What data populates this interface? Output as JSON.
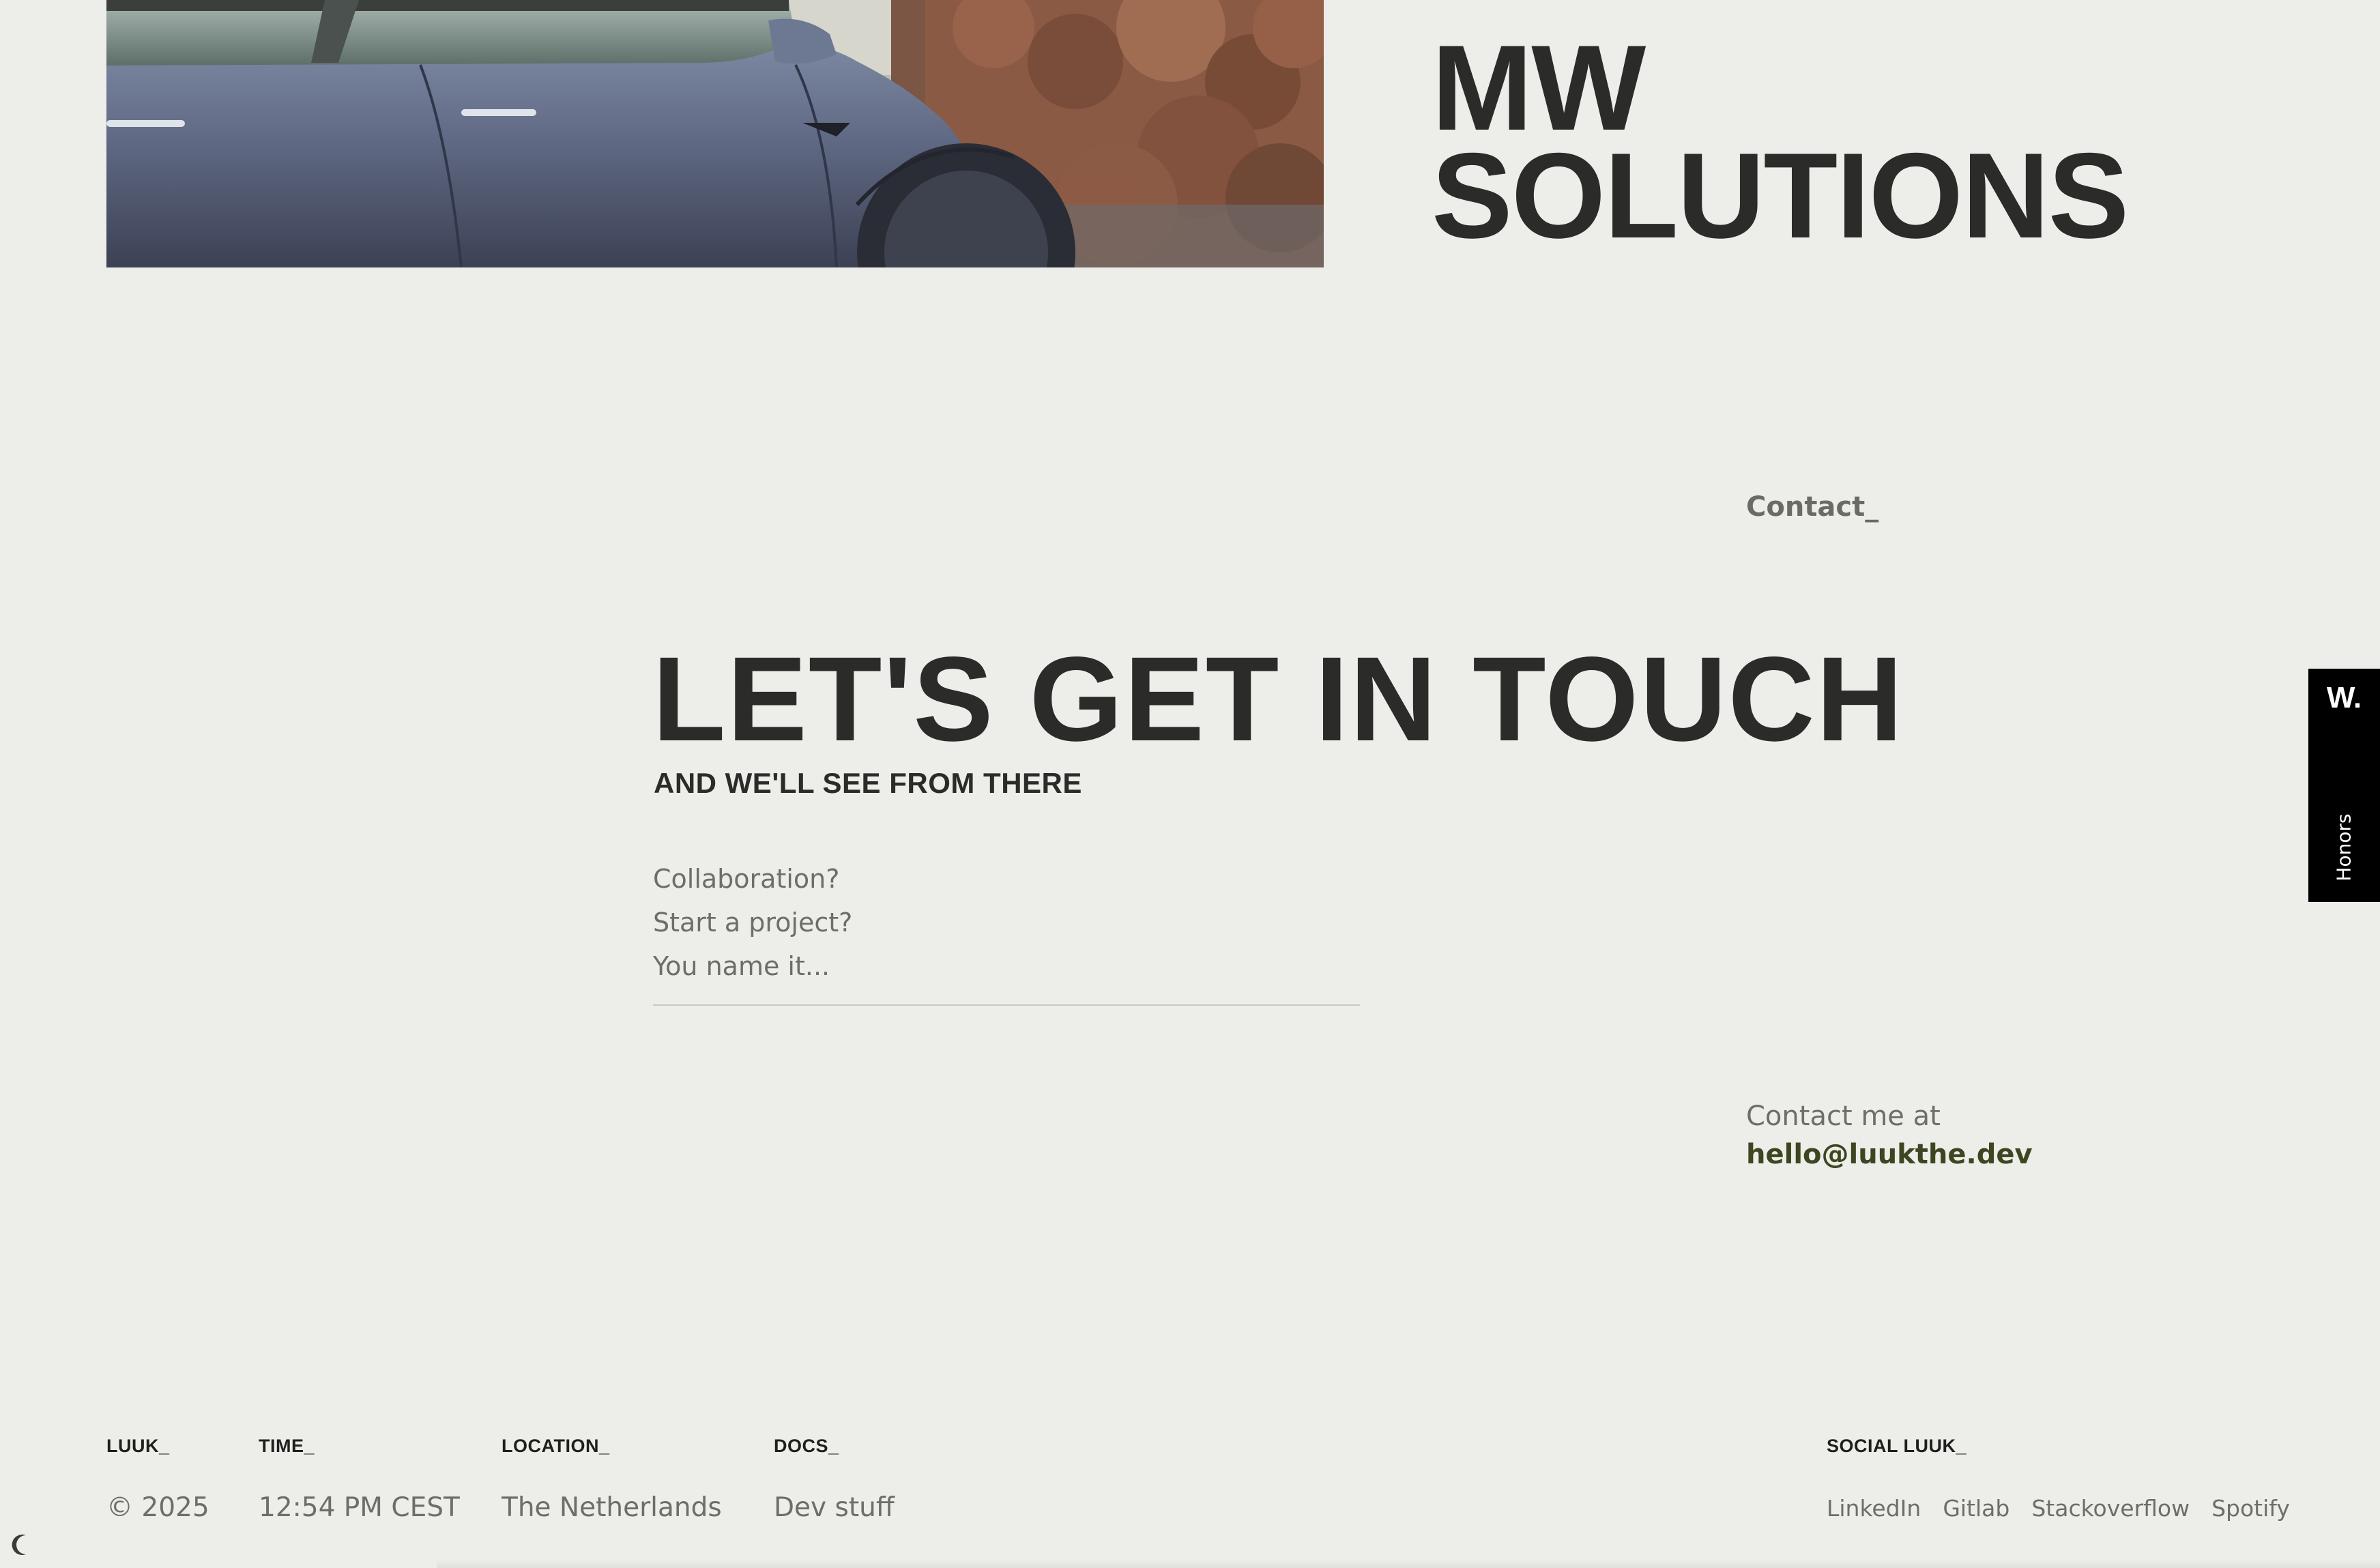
{
  "hero": {
    "brand_line1": "MW",
    "brand_line2": "SOLUTIONS"
  },
  "nav": {
    "contact_label": "Contact_"
  },
  "contact_section": {
    "headline": "LET'S GET IN TOUCH",
    "subheadline": "AND WE'LL SEE FROM THERE",
    "prompts": [
      "Collaboration?",
      "Start a project?",
      "You name it..."
    ],
    "contact_intro": "Contact me at",
    "email": "hello@luukthe.dev"
  },
  "side_tab": {
    "logo": "W.",
    "label": "Honors"
  },
  "footer": {
    "columns": [
      {
        "label": "LUUK_",
        "value": "© 2025"
      },
      {
        "label": "TIME_",
        "value": "12:54 PM CEST"
      },
      {
        "label": "LOCATION_",
        "value": "The Netherlands"
      },
      {
        "label": "DOCS_",
        "value": "Dev stuff"
      }
    ],
    "social": {
      "label": "SOCIAL LUUK_",
      "links": [
        "LinkedIn",
        "Gitlab",
        "Stackoverflow",
        "Spotify"
      ]
    }
  },
  "icons": {
    "theme_toggle": "moon-icon"
  },
  "colors": {
    "background": "#edede9",
    "text_dark": "#2b2b29",
    "text_muted": "#6e6e69",
    "email_accent": "#3c4620",
    "side_tab": "#000000"
  }
}
